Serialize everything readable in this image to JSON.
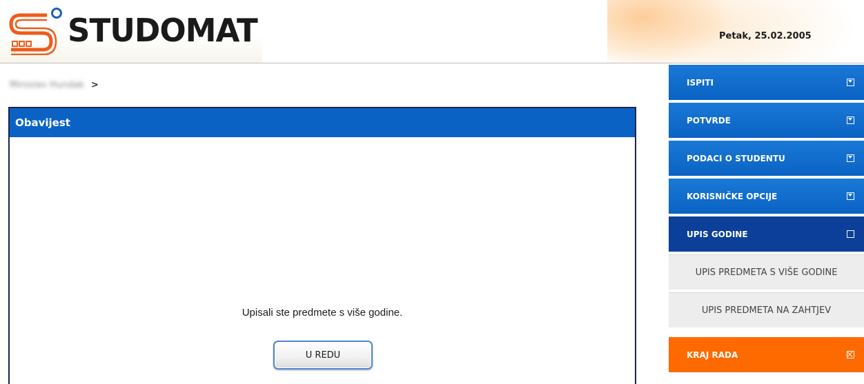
{
  "header": {
    "logo_text": "STUDOMAT",
    "date": "Petak, 25.02.2005"
  },
  "breadcrumb": {
    "user": "Miroslav Hundak",
    "separator": ">"
  },
  "notice": {
    "title": "Obavijest",
    "message": "Upisali ste predmete s više godine.",
    "ok_label": "U REDU"
  },
  "menu": {
    "items": [
      {
        "label": "ISPITI",
        "icon": "expand-icon"
      },
      {
        "label": "POTVRDE",
        "icon": "expand-icon"
      },
      {
        "label": "PODACI O STUDENTU",
        "icon": "expand-icon"
      },
      {
        "label": "KORISNIČKE OPCIJE",
        "icon": "expand-icon"
      },
      {
        "label": "UPIS GODINE",
        "icon": "collapse-icon"
      },
      {
        "label": "UPIS PREDMETA S VIŠE GODINE"
      },
      {
        "label": "UPIS PREDMETA NA ZAHTJEV"
      },
      {
        "label": "KRAJ RADA",
        "icon": "close-icon"
      }
    ]
  },
  "colors": {
    "menu_blue": "#0a63c4",
    "menu_active": "#0b3f99",
    "menu_sub": "#ededed",
    "menu_exit": "#ff6a00",
    "title_bar": "#0a63c4"
  }
}
